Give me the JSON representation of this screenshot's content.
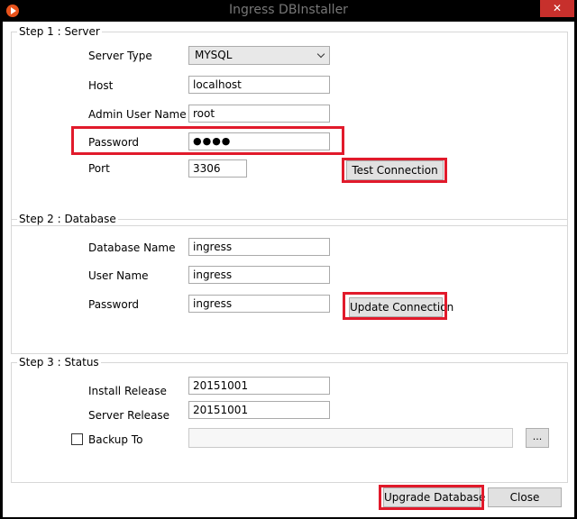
{
  "window": {
    "title": "Ingress DBInstaller",
    "close_glyph": "✕"
  },
  "step1": {
    "title": "Step 1 : Server",
    "server_type_label": "Server Type",
    "server_type_value": "MYSQL",
    "host_label": "Host",
    "host_value": "localhost",
    "admin_user_label": "Admin User Name",
    "admin_user_value": "root",
    "password_label": "Password",
    "password_mask": "●●●●",
    "port_label": "Port",
    "port_value": "3306",
    "test_connection_label": "Test Connection"
  },
  "step2": {
    "title": "Step 2 : Database",
    "db_name_label": "Database Name",
    "db_name_value": "ingress",
    "user_name_label": "User Name",
    "user_name_value": "ingress",
    "password_label": "Password",
    "password_value": "ingress",
    "update_connection_label": "Update Connection"
  },
  "step3": {
    "title": "Step 3 : Status",
    "install_release_label": "Install Release",
    "install_release_value": "20151001",
    "server_release_label": "Server Release",
    "server_release_value": "20151001",
    "backup_to_label": "Backup To",
    "backup_to_value": "",
    "browse_label": "..."
  },
  "footer": {
    "upgrade_label": "Upgrade Database",
    "close_label": "Close"
  },
  "colors": {
    "highlight": "#e11a2b",
    "titlebar": "#000000",
    "close": "#c7302c"
  }
}
